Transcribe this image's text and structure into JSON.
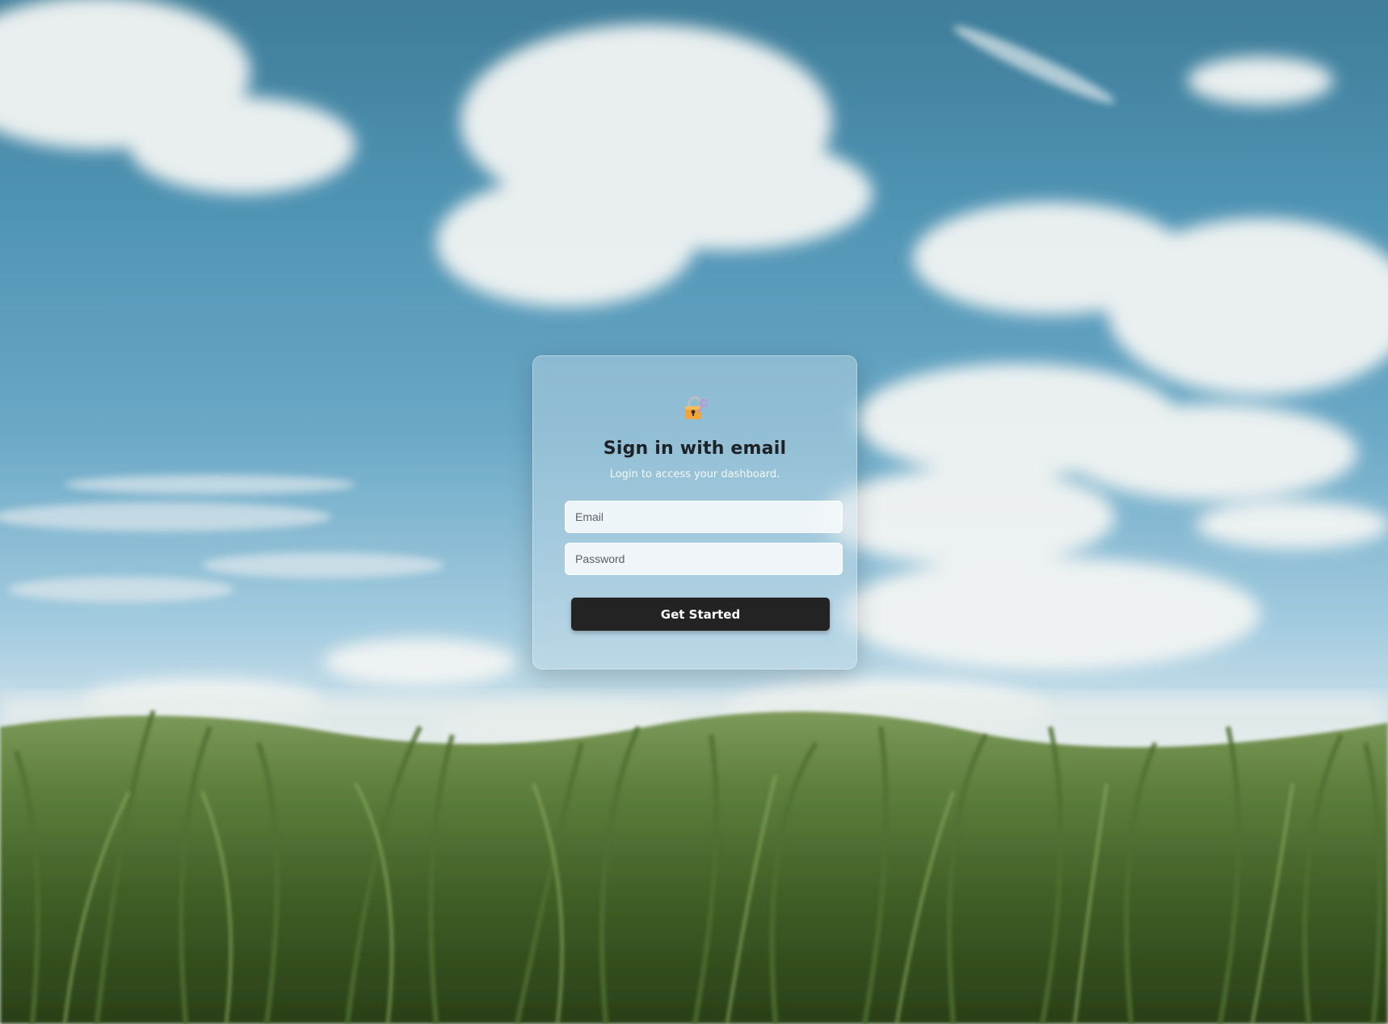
{
  "login": {
    "icon": "lock-with-key-icon",
    "title": "Sign in with email",
    "subtitle": "Login to access your dashboard.",
    "email_placeholder": "Email",
    "password_placeholder": "Password",
    "submit_label": "Get Started"
  },
  "theme": {
    "button_color": "#232323",
    "button_text_color": "#ffffff",
    "title_color": "#1d2226"
  },
  "background": {
    "scene": "sky-with-clouds-over-cornfield"
  }
}
